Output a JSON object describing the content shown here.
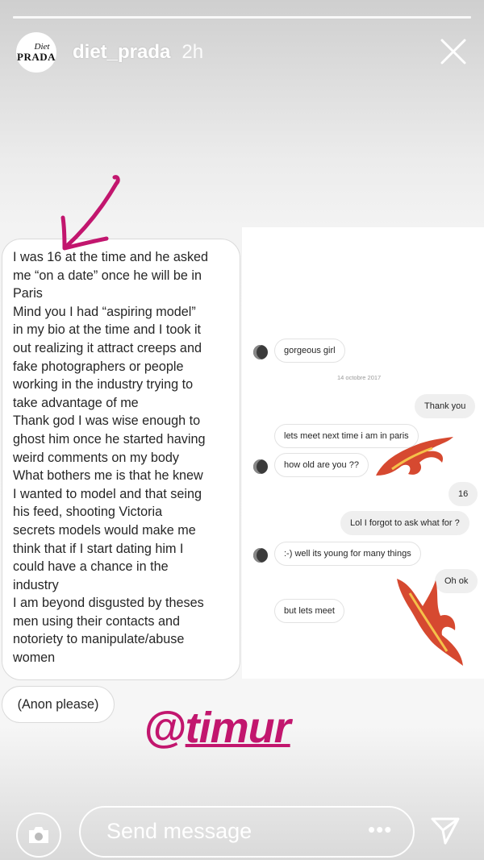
{
  "story": {
    "username": "diet_prada",
    "time_ago": "2h",
    "avatar_logo_top": "Diet",
    "avatar_logo_bottom": "PRADA"
  },
  "left_message": {
    "lines": [
      "I was 16 at the time and he asked",
      "me “on a date” once he will be in",
      "Paris",
      "Mind you I had “aspiring model”",
      "in my bio at the time and I took it",
      "out realizing it attract creeps and",
      "fake photographers or people",
      "working in the industry trying to",
      "take advantage of me",
      "Thank god I was wise enough to",
      "ghost him once he started having",
      "weird comments on my body",
      "What bothers me is that he knew",
      "I wanted to model and that seing",
      "his feed, shooting Victoria",
      "secrets models would make me",
      "think that if I start dating him I",
      "could have a chance in the",
      "industry",
      "I am beyond disgusted by theses",
      "men using their contacts and",
      "notoriety to manipulate/abuse",
      "women"
    ],
    "anon_note": "(Anon please)"
  },
  "chat_screenshot": {
    "date_label": "14 octobre 2017",
    "messages": {
      "m1": "gorgeous girl",
      "m2": "Thank you",
      "m3": "lets meet next time i am in paris",
      "m4": "how old are you ??",
      "m5": "16",
      "m6": "Lol I forgot to ask what for ?",
      "m7": ":-) well its young for many things",
      "m8": "Oh ok",
      "m9": "but lets meet"
    }
  },
  "overlay": {
    "tag_at": "@",
    "tag_name": "timur",
    "tag_color": "#c2166e",
    "arrow_color": "#c2166e",
    "flame_color": "#d23a1e"
  },
  "footer": {
    "message_placeholder": "Send message",
    "more_label": "•••"
  },
  "icons": {
    "close": "close-icon",
    "camera": "camera-icon",
    "send": "send-icon"
  }
}
